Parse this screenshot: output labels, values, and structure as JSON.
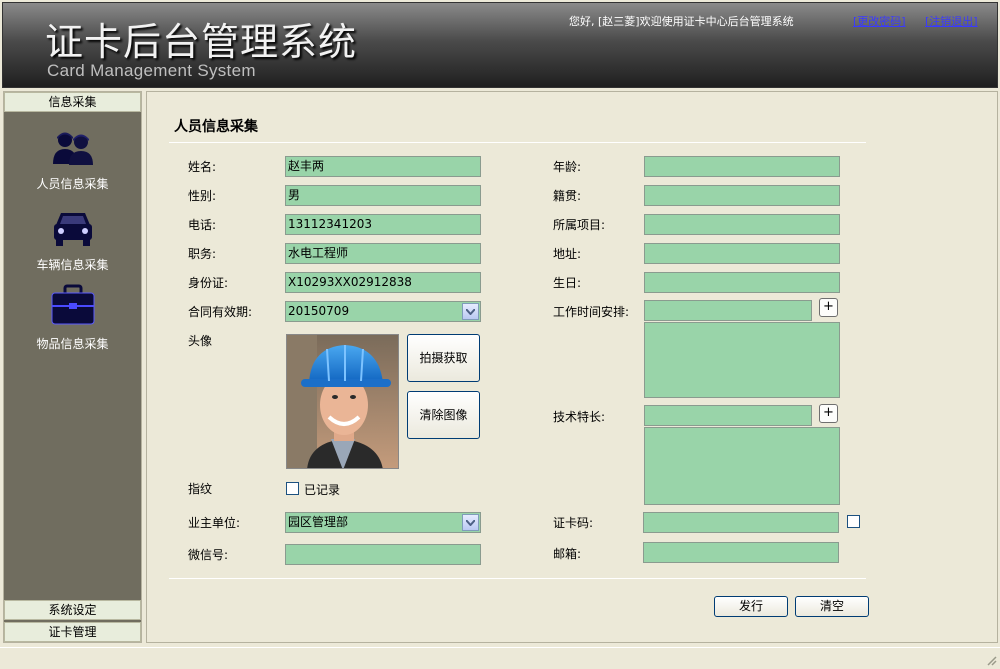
{
  "header": {
    "title_cn": "证卡后台管理系统",
    "title_en": "Card Management System",
    "welcome": "您好, [赵三菱]欢迎使用证卡中心后台管理系统",
    "change_password": "[更改密码]",
    "logout": "[注销退出]"
  },
  "sidebar": {
    "section_top": "信息采集",
    "items": [
      {
        "label": "人员信息采集",
        "icon": "people-icon"
      },
      {
        "label": "车辆信息采集",
        "icon": "car-icon"
      },
      {
        "label": "物品信息采集",
        "icon": "briefcase-icon"
      }
    ],
    "section_settings": "系统设定",
    "section_cards": "证卡管理"
  },
  "form": {
    "title": "人员信息采集",
    "name_label": "姓名:",
    "name_value": "赵丰两",
    "gender_label": "性别:",
    "gender_value": "男",
    "phone_label": "电话:",
    "phone_value": "13112341203",
    "job_label": "职务:",
    "job_value": "水电工程师",
    "id_label": "身份证:",
    "id_value": "X10293XX02912838",
    "contract_label": "合同有效期:",
    "contract_value": "20150709",
    "avatar_label": "头像",
    "capture_button": "拍摄获取",
    "clear_image_button": "清除图像",
    "fingerprint_label": "指纹",
    "fingerprint_checkbox_label": "已记录",
    "owner_unit_label": "业主单位:",
    "owner_unit_value": "园区管理部",
    "wechat_label": "微信号:",
    "wechat_value": "",
    "age_label": "年龄:",
    "age_value": "",
    "origin_label": "籍贯:",
    "origin_value": "",
    "project_label": "所属项目:",
    "project_value": "",
    "address_label": "地址:",
    "address_value": "",
    "birthday_label": "生日:",
    "birthday_value": "",
    "schedule_label": "工作时间安排:",
    "schedule_value": "",
    "skills_label": "技术特长:",
    "skills_value": "",
    "card_code_label": "证卡码:",
    "card_code_value": "",
    "email_label": "邮箱:",
    "email_value": "",
    "plus_symbol": "+",
    "issue_button": "发行",
    "clear_button": "清空"
  },
  "colors": {
    "field_bg": "#99d4a9",
    "sidebar_bg": "#706d5f",
    "page_bg": "#ece9d8",
    "link": "#3a3aff"
  }
}
